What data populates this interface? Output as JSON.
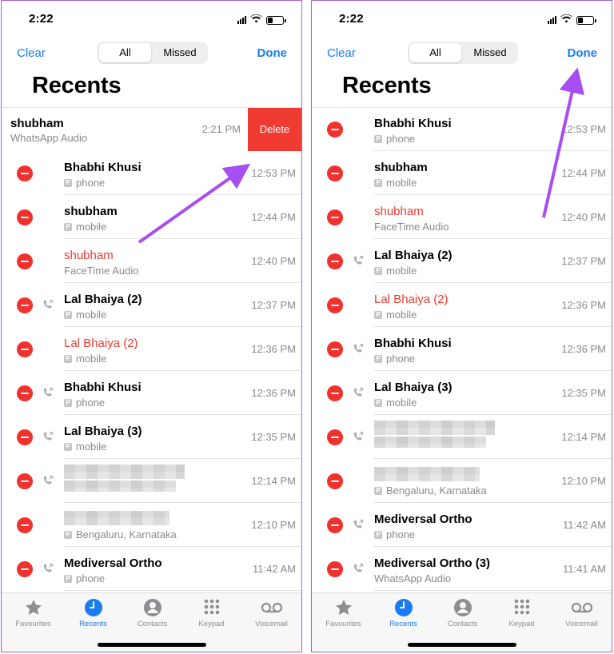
{
  "colors": {
    "accent": "#1a7cf2",
    "missed": "#ee3a31",
    "delete": "#f03b32",
    "annotation_arrow": "#a74ef2"
  },
  "phones": [
    {
      "status": {
        "time": "2:22"
      },
      "nav": {
        "clear": "Clear",
        "done": "Done",
        "segments": [
          "All",
          "Missed"
        ],
        "selected": "All"
      },
      "title": "Recents",
      "swiped": {
        "name": "shubham",
        "sub": "WhatsApp Audio",
        "time": "2:21 PM",
        "action": "Delete"
      },
      "calls": [
        {
          "name": "Bhabhi Khusi",
          "sub": "phone",
          "time": "12:53 PM",
          "missed": false,
          "outgoing": false
        },
        {
          "name": "shubham",
          "sub": "mobile",
          "time": "12:44 PM",
          "missed": false,
          "outgoing": false
        },
        {
          "name": "shubham",
          "sub": "FaceTime Audio",
          "time": "12:40 PM",
          "missed": true,
          "outgoing": false
        },
        {
          "name": "Lal Bhaiya (2)",
          "sub": "mobile",
          "time": "12:37 PM",
          "missed": false,
          "outgoing": true
        },
        {
          "name": "Lal Bhaiya (2)",
          "sub": "mobile",
          "time": "12:36 PM",
          "missed": true,
          "outgoing": false
        },
        {
          "name": "Bhabhi Khusi",
          "sub": "phone",
          "time": "12:36 PM",
          "missed": false,
          "outgoing": true
        },
        {
          "name": "Lal Bhaiya (3)",
          "sub": "mobile",
          "time": "12:35 PM",
          "missed": false,
          "outgoing": true
        },
        {
          "name": "",
          "sub": "",
          "time": "12:14 PM",
          "missed": false,
          "outgoing": true,
          "redacted": true
        },
        {
          "name": "",
          "sub": "Bengaluru, Karnataka",
          "time": "12:10 PM",
          "missed": false,
          "outgoing": false,
          "redacted": true
        },
        {
          "name": "Mediversal Ortho",
          "sub": "phone",
          "time": "11:42 AM",
          "missed": false,
          "outgoing": true
        }
      ]
    },
    {
      "status": {
        "time": "2:22"
      },
      "nav": {
        "clear": "Clear",
        "done": "Done",
        "segments": [
          "All",
          "Missed"
        ],
        "selected": "All"
      },
      "title": "Recents",
      "calls": [
        {
          "name": "Bhabhi Khusi",
          "sub": "phone",
          "time": "12:53 PM",
          "missed": false,
          "outgoing": false
        },
        {
          "name": "shubham",
          "sub": "mobile",
          "time": "12:44 PM",
          "missed": false,
          "outgoing": false
        },
        {
          "name": "shubham",
          "sub": "FaceTime Audio",
          "time": "12:40 PM",
          "missed": true,
          "outgoing": false
        },
        {
          "name": "Lal Bhaiya (2)",
          "sub": "mobile",
          "time": "12:37 PM",
          "missed": false,
          "outgoing": true
        },
        {
          "name": "Lal Bhaiya (2)",
          "sub": "mobile",
          "time": "12:36 PM",
          "missed": true,
          "outgoing": false
        },
        {
          "name": "Bhabhi Khusi",
          "sub": "phone",
          "time": "12:36 PM",
          "missed": false,
          "outgoing": true
        },
        {
          "name": "Lal Bhaiya (3)",
          "sub": "mobile",
          "time": "12:35 PM",
          "missed": false,
          "outgoing": true
        },
        {
          "name": "",
          "sub": "",
          "time": "12:14 PM",
          "missed": false,
          "outgoing": true,
          "redacted": true
        },
        {
          "name": "",
          "sub": "Bengaluru, Karnataka",
          "time": "12:10 PM",
          "missed": false,
          "outgoing": false,
          "redacted": true
        },
        {
          "name": "Mediversal Ortho",
          "sub": "phone",
          "time": "11:42 AM",
          "missed": false,
          "outgoing": true
        },
        {
          "name": "Mediversal Ortho (3)",
          "sub": "WhatsApp Audio",
          "time": "11:41 AM",
          "missed": false,
          "outgoing": true
        }
      ]
    }
  ],
  "tabbar": {
    "items": [
      {
        "label": "Favourites",
        "icon": "star-icon",
        "active": false
      },
      {
        "label": "Recents",
        "icon": "clock-icon",
        "active": true
      },
      {
        "label": "Contacts",
        "icon": "person-icon",
        "active": false
      },
      {
        "label": "Keypad",
        "icon": "keypad-icon",
        "active": false
      },
      {
        "label": "Voicemail",
        "icon": "voicemail-icon",
        "active": false
      }
    ]
  }
}
